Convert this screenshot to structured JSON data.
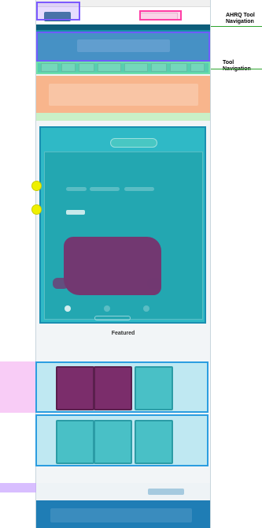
{
  "callouts": {
    "ahrq_tool_navigation": "AHRQ Tool Navigation",
    "tool_navigation": "Tool Navigation"
  },
  "featured": {
    "title": "Featured"
  }
}
